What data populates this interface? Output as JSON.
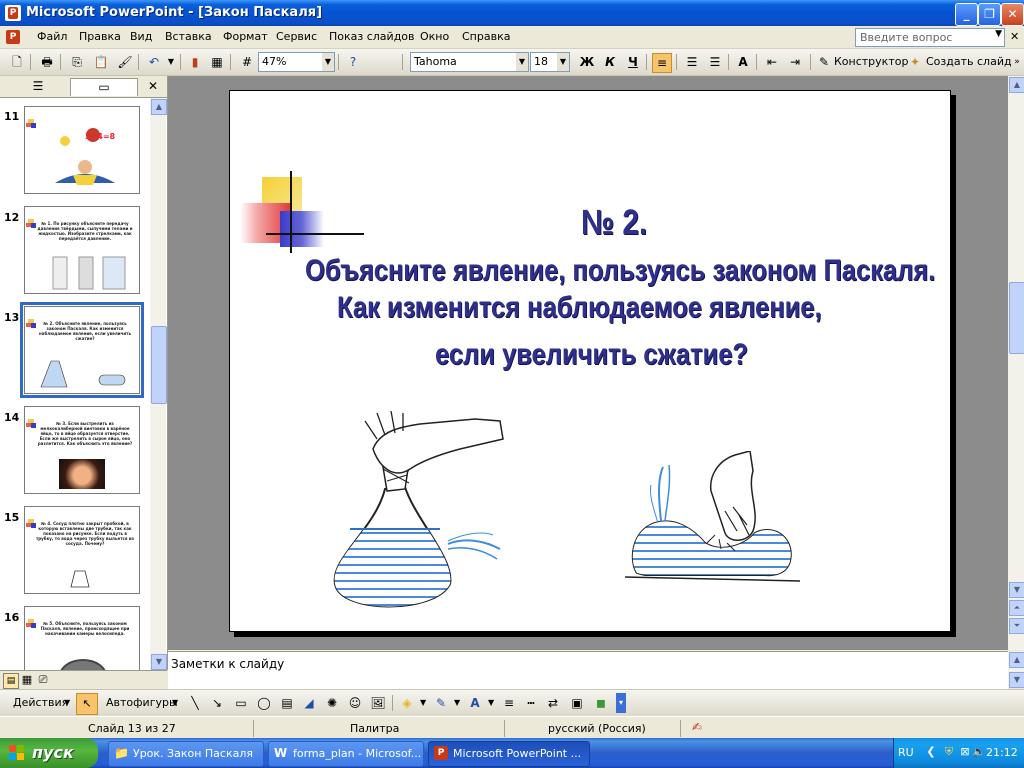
{
  "window": {
    "title": "Microsoft PowerPoint - [Закон Паскаля]",
    "app_icon": "powerpoint-icon",
    "buttons": [
      "minimize",
      "restore",
      "close"
    ]
  },
  "menu": {
    "items": [
      "Файл",
      "Правка",
      "Вид",
      "Вставка",
      "Формат",
      "Сервис",
      "Показ слайдов",
      "Окно",
      "Справка"
    ],
    "help_placeholder": "Введите вопрос"
  },
  "toolbar": {
    "zoom": "47%",
    "font_name": "Tahoma",
    "font_size": "18",
    "bold": "Ж",
    "italic": "К",
    "underline": "Ч",
    "designer_label": "Конструктор",
    "new_slide_label": "Создать слайд"
  },
  "outline_pane": {
    "close_glyph": "✕",
    "thumbnails": [
      {
        "number": "11",
        "caption": ""
      },
      {
        "number": "12",
        "caption": "№ 1. По рисунку объясните передачу давления твёрдыми, сыпучими телами и жидкостью. Изобразите стрелками, как передаётся давление."
      },
      {
        "number": "13",
        "caption": "№ 2. Объясните явление, пользуясь законом Паскаля. Как изменится наблюдаемое явление, если увеличить сжатие?"
      },
      {
        "number": "14",
        "caption": "№ 3. Если выстрелить из мелкокалиберной винтовки в варёное яйцо, то в яйце образуется отверстие. Если же выстрелить в сырое яйцо, оно разлетится. Как объяснить это явление?"
      },
      {
        "number": "15",
        "caption": "№ 4. Сосуд плотно закрыт пробкой, в которую вставлены две трубки, так как показано на рисунке. Если подуть в трубку, то вода через трубку выльется из сосуда. Почему?"
      },
      {
        "number": "16",
        "caption": "№ 5. Объясните, пользуясь законом Паскаля, явление, происходящее при накачивании камеры велосипеда."
      }
    ],
    "selected": "13"
  },
  "slide": {
    "number_heading": "№ 2.",
    "lines": [
      "Объясните явление, пользуясь законом Паскаля.",
      "Как изменится наблюдаемое явление,",
      "если увеличить сжатие?"
    ],
    "text_color": "#2F2F8C"
  },
  "notes": {
    "placeholder": "Заметки к слайду"
  },
  "drawing_toolbar": {
    "actions_label": "Действия",
    "autoshapes_label": "Автофигуры"
  },
  "statusbar": {
    "slide_info": "Слайд 13 из 27",
    "design": "Палитра",
    "language": "русский (Россия)"
  },
  "taskbar": {
    "start_label": "пуск",
    "tasks": [
      {
        "label": "Урок. Закон Паскаля",
        "icon": "folder-icon"
      },
      {
        "label": "forma_plan - Microsof...",
        "icon": "word-icon"
      },
      {
        "label": "Microsoft PowerPoint ...",
        "icon": "powerpoint-icon"
      }
    ],
    "lang": "RU",
    "clock": "21:12"
  }
}
